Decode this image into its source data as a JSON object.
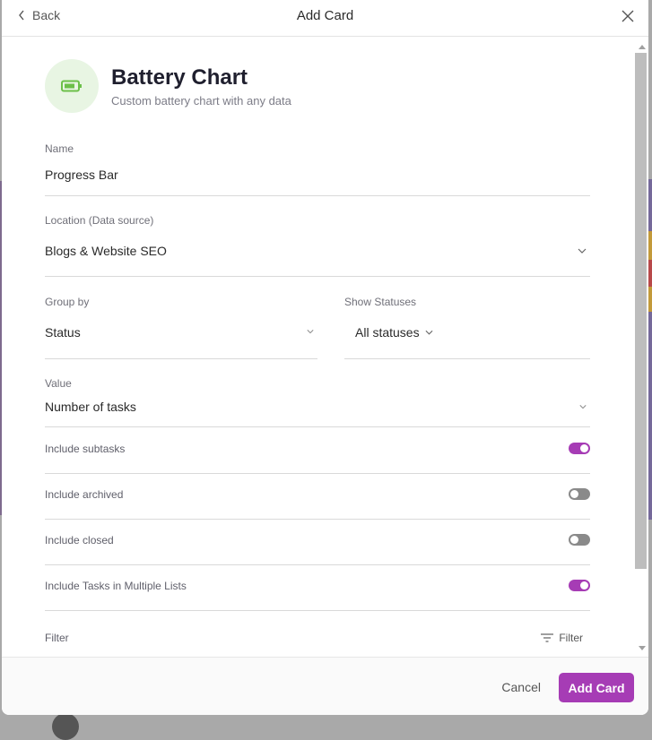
{
  "colors": {
    "accent": "#a63cb5",
    "toggle_off": "#8a8a8a",
    "battery_green": "#6cc04a",
    "hero_bg": "#e8f5e3"
  },
  "header": {
    "back_label": "Back",
    "title": "Add Card",
    "back_icon": "chevron-left-icon",
    "close_icon": "close-icon"
  },
  "hero": {
    "icon": "battery-icon",
    "title": "Battery Chart",
    "subtitle": "Custom battery chart with any data"
  },
  "form": {
    "name": {
      "label": "Name",
      "value": "Progress Bar"
    },
    "location": {
      "label": "Location (Data source)",
      "value": "Blogs & Website SEO"
    },
    "group_by": {
      "label": "Group by",
      "value": "Status"
    },
    "show_statuses": {
      "label": "Show Statuses",
      "value": "All statuses"
    },
    "value": {
      "label": "Value",
      "value": "Number of tasks"
    },
    "toggles": [
      {
        "label": "Include subtasks",
        "on": true
      },
      {
        "label": "Include archived",
        "on": false
      },
      {
        "label": "Include closed",
        "on": false
      },
      {
        "label": "Include Tasks in Multiple Lists",
        "on": true
      }
    ],
    "filter": {
      "label": "Filter",
      "button_label": "Filter",
      "icon": "filter-icon"
    }
  },
  "footer": {
    "cancel_label": "Cancel",
    "add_label": "Add Card"
  }
}
